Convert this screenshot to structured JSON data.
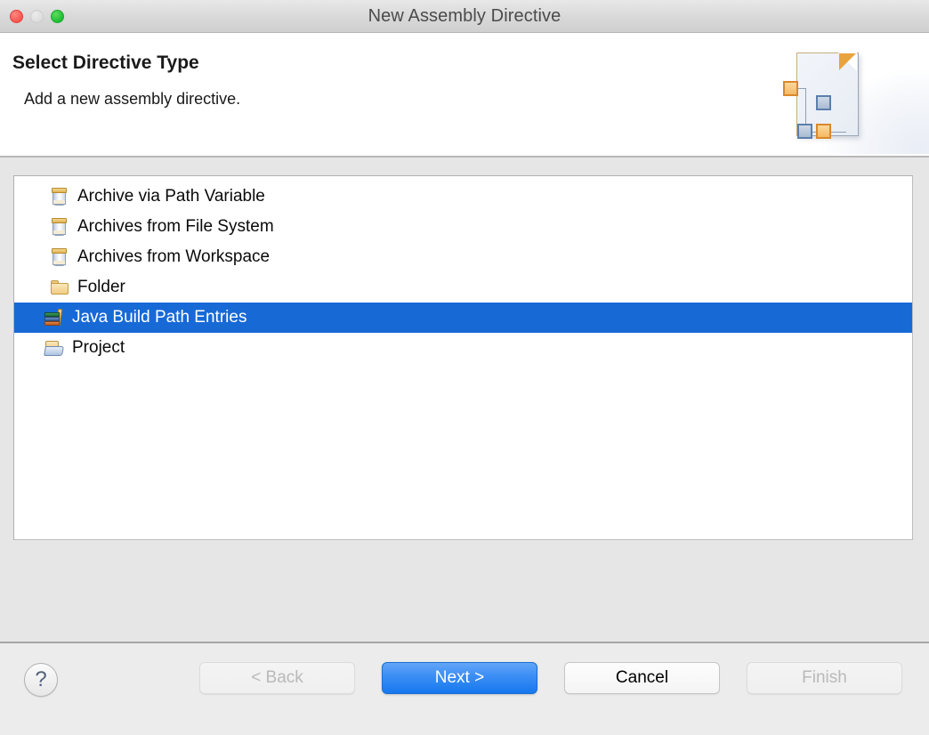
{
  "window": {
    "title": "New Assembly Directive",
    "traffic_lights": [
      {
        "name": "close",
        "color": "#f8544f"
      },
      {
        "name": "minimize",
        "color": "#dcdcdc"
      },
      {
        "name": "zoom",
        "color": "#1cbe33"
      }
    ]
  },
  "header": {
    "title": "Select Directive Type",
    "description": "Add a new assembly directive.",
    "artwork": "assembly-document-icon"
  },
  "list": {
    "items": [
      {
        "label": "Archive via Path Variable",
        "icon": "jar-icon",
        "selected": false,
        "shifted": false
      },
      {
        "label": "Archives from File System",
        "icon": "jar-icon",
        "selected": false,
        "shifted": false
      },
      {
        "label": "Archives from Workspace",
        "icon": "jar-icon",
        "selected": false,
        "shifted": false
      },
      {
        "label": "Folder",
        "icon": "folder-icon",
        "selected": false,
        "shifted": false
      },
      {
        "label": "Java Build Path Entries",
        "icon": "books-icon",
        "selected": true,
        "shifted": true
      },
      {
        "label": "Project",
        "icon": "open-folder-icon",
        "selected": false,
        "shifted": true
      }
    ],
    "selected_index": 4,
    "selection_color": "#1769d6"
  },
  "footer": {
    "help_label": "?",
    "buttons": [
      {
        "label": "< Back",
        "name": "back-button",
        "state": "disabled"
      },
      {
        "label": "Next >",
        "name": "next-button",
        "state": "primary"
      },
      {
        "label": "Cancel",
        "name": "cancel-button",
        "state": "normal"
      },
      {
        "label": "Finish",
        "name": "finish-button",
        "state": "disabled"
      }
    ]
  }
}
